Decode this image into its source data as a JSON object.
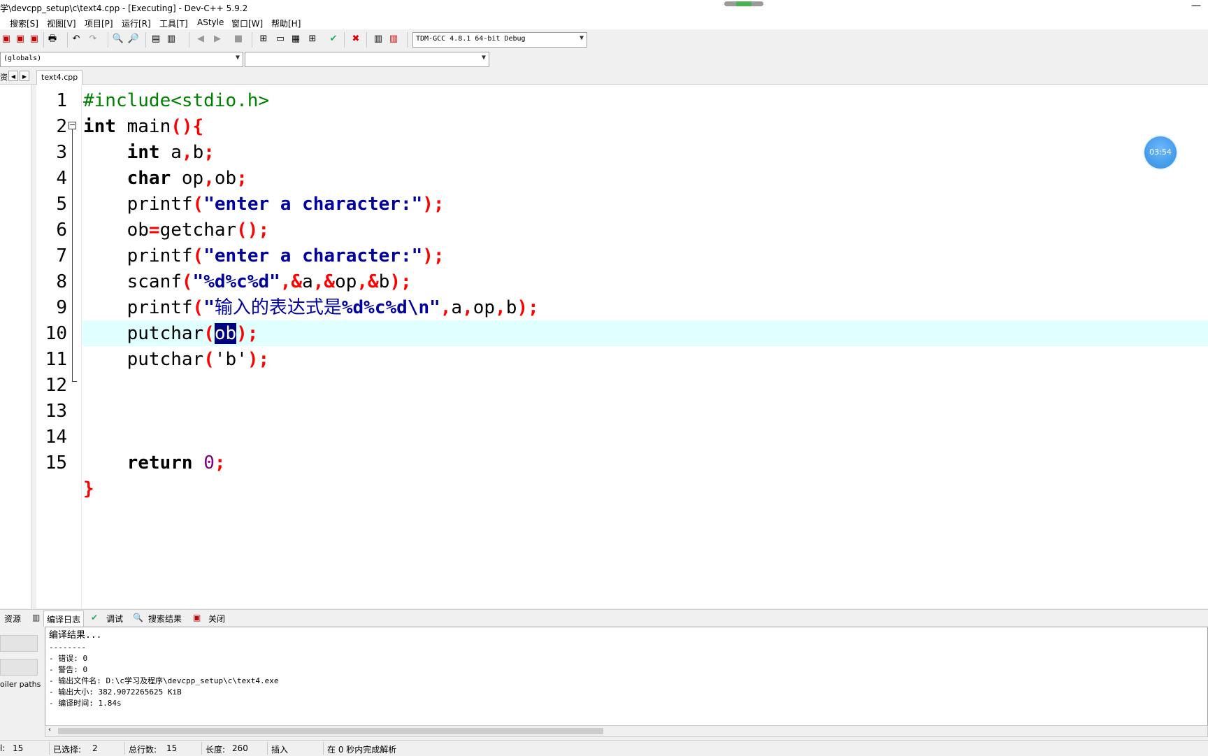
{
  "window": {
    "title": "学\\devcpp_setup\\c\\text4.cpp - [Executing] - Dev-C++ 5.9.2"
  },
  "menu": [
    "搜索[S]",
    "视图[V]",
    "项目[P]",
    "运行[R]",
    "工具[T]",
    "AStyle",
    "窗口[W]",
    "帮助[H]"
  ],
  "toolbar": {
    "compiler": "TDM-GCC 4.8.1 64-bit Debug"
  },
  "scope": {
    "left": "(globals)",
    "right": ""
  },
  "tabs": {
    "left_label": "资",
    "file": "text4.cpp"
  },
  "timer": "03:54",
  "code": {
    "line_numbers": [
      "1",
      "2",
      "3",
      "4",
      "5",
      "6",
      "7",
      "8",
      "9",
      "10",
      "11",
      "12",
      "13",
      "14",
      "15"
    ],
    "l1": "#include<stdio.h>",
    "l2_kw": "int",
    "l2_rest": " main",
    "l2_sym": "(){",
    "l3_ind": "    ",
    "l3_kw": "int",
    "l3_a": " a",
    "l3_c": ",",
    "l3_b": "b",
    "l3_s": ";",
    "l4_ind": "    ",
    "l4_kw": "char",
    "l4_a": " op",
    "l4_c": ",",
    "l4_b": "ob",
    "l4_s": ";",
    "l5_a": "    printf",
    "l5_p": "(",
    "l5_str": "\"enter a character:\"",
    "l5_e": ");",
    "l6_a": "    ob",
    "l6_eq": "=",
    "l6_b": "getchar",
    "l6_e": "();",
    "l7_a": "    printf",
    "l7_p": "(",
    "l7_str": "\"enter a character:\"",
    "l7_e": ");",
    "l8_a": "    scanf",
    "l8_p": "(",
    "l8_str": "\"%d%c%d\"",
    "l8_c1": ",&",
    "l8_v1": "a",
    "l8_c2": ",&",
    "l8_v2": "op",
    "l8_c3": ",&",
    "l8_v3": "b",
    "l8_e": ");",
    "l9_a": "    printf",
    "l9_p": "(",
    "l9_q": "\"",
    "l9_cn": "输入的表达式是",
    "l9_str": "%d%c%d\\n\"",
    "l9_c1": ",",
    "l9_v1": "a",
    "l9_c2": ",",
    "l9_v2": "op",
    "l9_c3": ",",
    "l9_v3": "b",
    "l9_e": ");",
    "l10_a": "    putchar",
    "l10_p": "(",
    "l10_sel": "ob",
    "l10_e": ");",
    "l11_a": "    putchar",
    "l11_p": "(",
    "l11_chr": "'b'",
    "l11_e": ");",
    "l14_ind": "    ",
    "l14_kw": "return",
    "l14_num": " 0",
    "l14_s": ";",
    "l15": "}"
  },
  "bottom_tabs": [
    "资源",
    "编译日志",
    "调试",
    "搜索结果",
    "关闭"
  ],
  "bottom_left": {
    "label": "oiler paths"
  },
  "log": [
    "编译结果...",
    "--------",
    "- 错误: 0",
    "- 警告: 0",
    "- 输出文件名: D:\\c学习及程序\\devcpp_setup\\c\\text4.exe",
    "- 输出大小: 382.9072265625 KiB",
    "- 编译时间: 1.84s"
  ],
  "status": {
    "line_label": "l:",
    "line_value": "15",
    "sel_label": "已选择:",
    "sel_value": "2",
    "total_label": "总行数:",
    "total_value": "15",
    "len_label": "长度:",
    "len_value": "260",
    "mode": "插入",
    "parse": "在 0 秒内完成解析"
  }
}
